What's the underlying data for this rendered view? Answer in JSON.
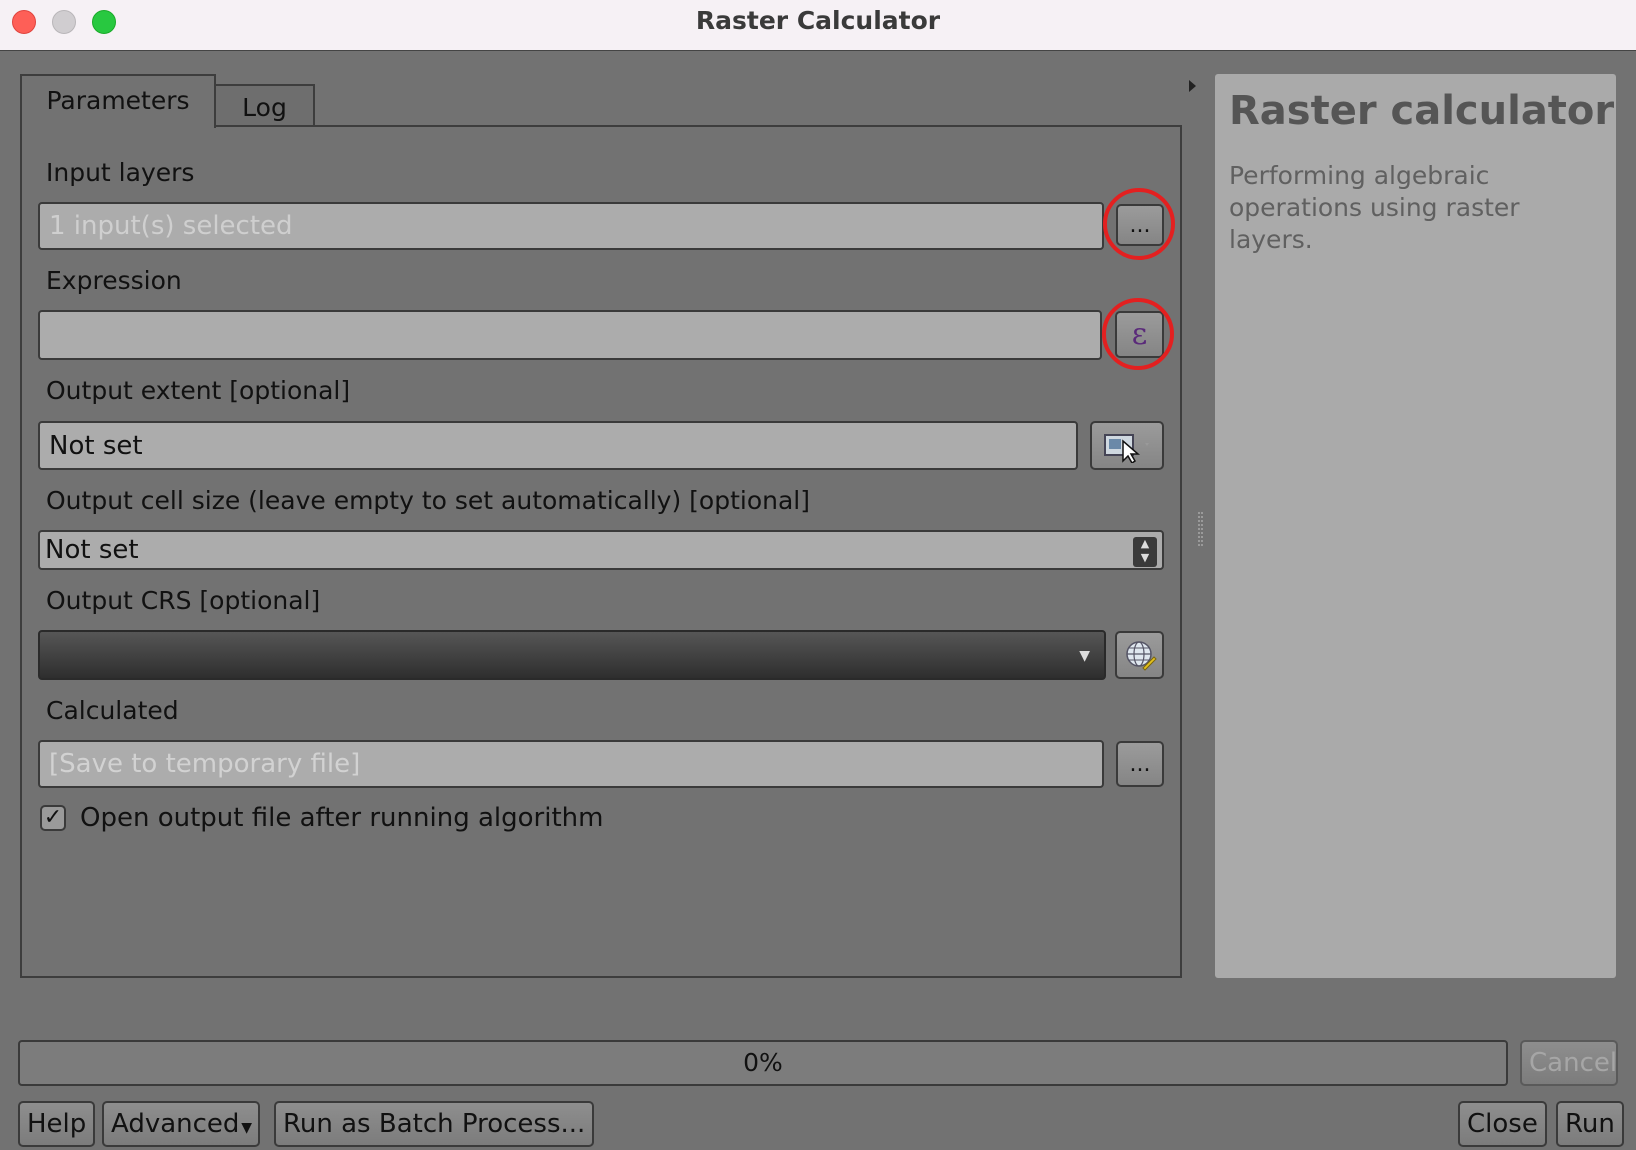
{
  "window": {
    "title": "Raster Calculator"
  },
  "tabs": [
    {
      "label": "Parameters",
      "active": true
    },
    {
      "label": "Log",
      "active": false
    }
  ],
  "params": {
    "input_layers": {
      "label": "Input layers",
      "placeholder": "1 input(s) selected",
      "button": "..."
    },
    "expression": {
      "label": "Expression",
      "value": "",
      "button_icon": "ε"
    },
    "output_extent": {
      "label": "Output extent [optional]",
      "value": "Not set"
    },
    "cell_size": {
      "label": "Output cell size (leave empty to set automatically) [optional]",
      "value": "Not set"
    },
    "crs": {
      "label": "Output CRS [optional]",
      "value": ""
    },
    "calculated": {
      "label": "Calculated",
      "placeholder": "[Save to temporary file]",
      "button": "..."
    },
    "open_output": {
      "label": "Open output file after running algorithm",
      "checked": true
    }
  },
  "help": {
    "title": "Raster calculator",
    "description": "Performing algebraic operations using raster layers."
  },
  "progress": {
    "percent": 0,
    "label": "0%"
  },
  "buttons": {
    "cancel": "Cancel",
    "help": "Help",
    "advanced": "Advanced",
    "batch": "Run as Batch Process...",
    "close": "Close",
    "run": "Run"
  },
  "icons": {
    "extent": "map-extent-icon",
    "crs": "globe-crs-icon",
    "expression": "epsilon-expression-icon"
  },
  "colors": {
    "highlight_ring": "#e32020",
    "window_bg": "#727272",
    "help_bg": "#aaaaaa"
  }
}
